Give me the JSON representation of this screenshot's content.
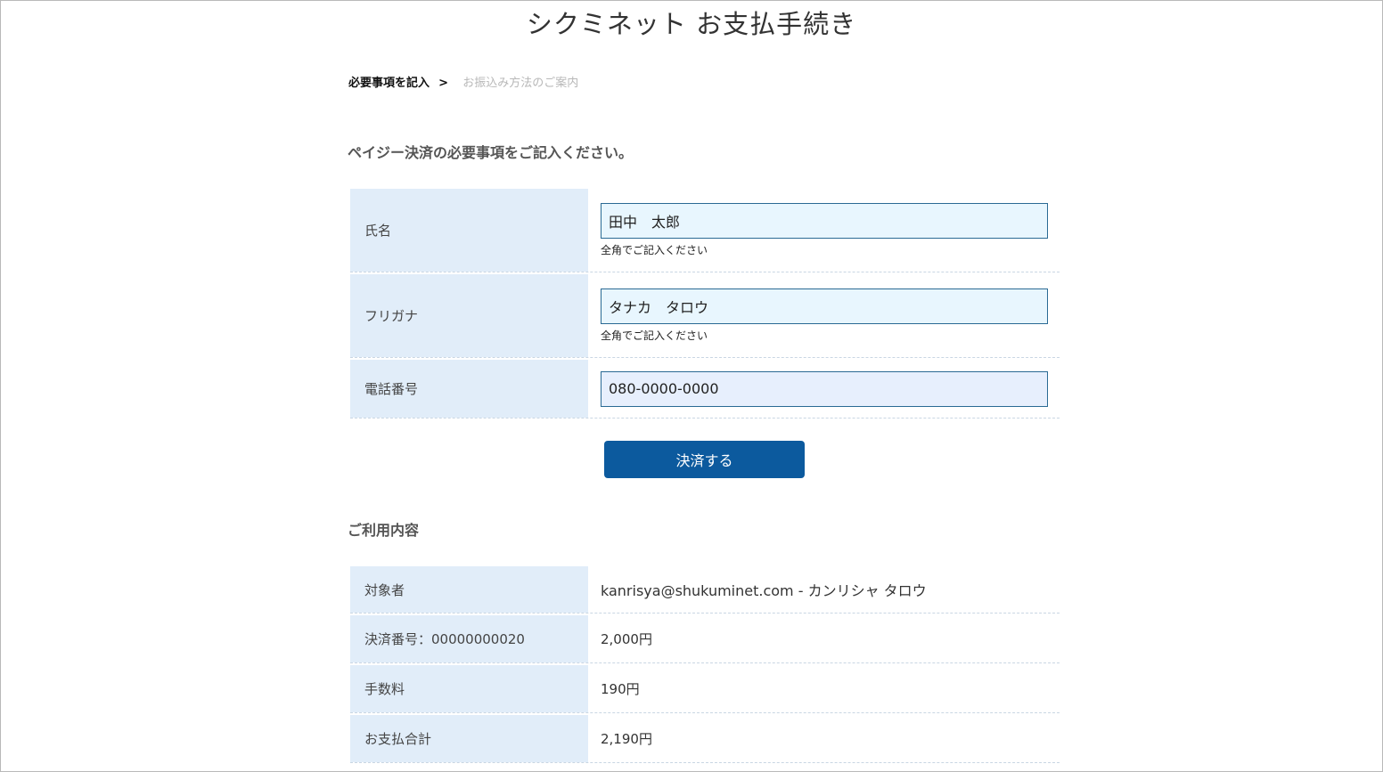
{
  "page": {
    "title": "シクミネット お支払手続き"
  },
  "breadcrumb": {
    "current": "必要事項を記入",
    "separator": ">",
    "next": "お振込み方法のご案内"
  },
  "form": {
    "heading": "ペイジー決済の必要事項をご記入ください。",
    "fields": [
      {
        "label": "氏名",
        "value": "田中　太郎",
        "hint": "全角でご記入ください"
      },
      {
        "label": "フリガナ",
        "value": "タナカ　タロウ",
        "hint": "全角でご記入ください"
      },
      {
        "label": "電話番号",
        "value": "080-0000-0000"
      }
    ],
    "submit_label": "決済する"
  },
  "usage": {
    "heading": "ご利用内容",
    "rows": [
      {
        "label": "対象者",
        "value": "kanrisya@shukuminet.com - カンリシャ タロウ"
      },
      {
        "label": "決済番号：00000000020",
        "value": "2,000円"
      },
      {
        "label": "手数料",
        "value": "190円"
      },
      {
        "label": "お支払合計",
        "value": "2,190円"
      }
    ]
  }
}
